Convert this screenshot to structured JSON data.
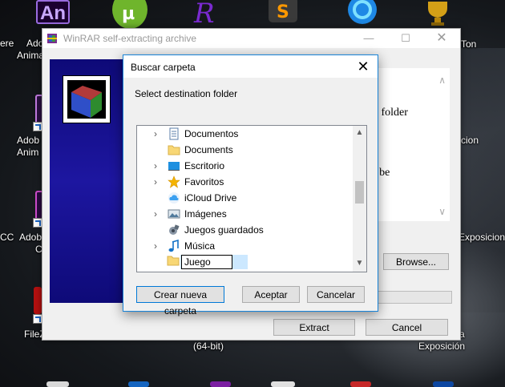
{
  "desktop": {
    "icons": [
      {
        "name": "adobe-animate",
        "label_lines": [
          "Adob",
          "Anima"
        ],
        "tile_text": "An",
        "tile_color": "#25003d"
      },
      {
        "name": "adobe-animate-2",
        "label_lines": [
          "Adob",
          "Anim"
        ],
        "tile_color": "#2a0f40"
      },
      {
        "name": "adobe-3",
        "label_lines": [
          "Adob",
          "C"
        ],
        "tile_color": "#2b0b3f"
      },
      {
        "name": "filezilla",
        "label_lines": [
          "FileZ"
        ],
        "tile_color": "#b41010"
      }
    ],
    "left_edge_labels": [
      "ere",
      "CC"
    ],
    "right_labels": [
      "Ton",
      "cion",
      "Exposicion"
    ],
    "bottom_right_label_lines": [
      "a",
      "Exposición"
    ],
    "bottom_label": "(64-bit)"
  },
  "winrar": {
    "title": "WinRAR self-extracting archive",
    "text_lines": [
      "on folder",
      "d",
      "ill be"
    ],
    "browse_label": "Browse...",
    "extract_label": "Extract",
    "cancel_label": "Cancel"
  },
  "dialog": {
    "title": "Buscar carpeta",
    "instruction": "Select destination folder",
    "tree": [
      {
        "label": "Documentos",
        "expandable": true,
        "icon": "documents-icon"
      },
      {
        "label": "Documents",
        "expandable": false,
        "icon": "folder-icon"
      },
      {
        "label": "Escritorio",
        "expandable": true,
        "icon": "desktop-icon"
      },
      {
        "label": "Favoritos",
        "expandable": true,
        "icon": "star-icon"
      },
      {
        "label": "iCloud Drive",
        "expandable": false,
        "icon": "cloud-icon"
      },
      {
        "label": "Imágenes",
        "expandable": true,
        "icon": "pictures-icon"
      },
      {
        "label": "Juegos guardados",
        "expandable": false,
        "icon": "saved-games-icon"
      },
      {
        "label": "Música",
        "expandable": true,
        "icon": "music-icon"
      }
    ],
    "editing_folder": "Juego",
    "new_folder_label": "Crear nueva carpeta",
    "accept_label": "Aceptar",
    "cancel_label": "Cancelar"
  },
  "colors": {
    "accent": "#0078d7",
    "selection": "#cce8ff",
    "winrar_panel": "#1a1080"
  }
}
